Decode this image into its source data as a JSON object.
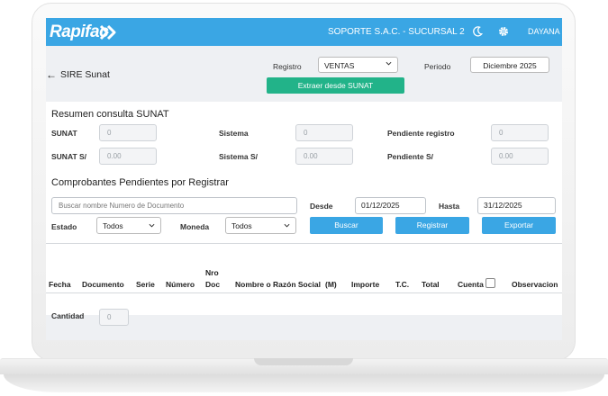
{
  "app": {
    "logo_text": "Rapifac",
    "company": "SOPORTE S.A.C. - SUCURSAL 2",
    "user": "DAYANA",
    "brand_color": "#3aa6e4",
    "accent_green": "#22b389"
  },
  "header": {
    "back_icon": "←",
    "title": "SIRE Sunat",
    "registro_label": "Registro",
    "registro_value": "VENTAS",
    "periodo_label": "Periodo",
    "periodo_value": "Diciembre 2025",
    "extract_button": "Extraer desde SUNAT"
  },
  "summary": {
    "heading": "Resumen consulta SUNAT",
    "sunat_label": "SUNAT",
    "sunat_value": "0",
    "sistema_label": "Sistema",
    "sistema_value": "0",
    "pendiente_registro_label": "Pendiente registro",
    "pendiente_registro_value": "0",
    "sunat_s_label": "SUNAT S/",
    "sunat_s_value": "0.00",
    "sistema_s_label": "Sistema S/",
    "sistema_s_value": "0.00",
    "pendiente_s_label": "Pendiente S/",
    "pendiente_s_value": "0.00"
  },
  "pending": {
    "heading": "Comprobantes Pendientes por Registrar",
    "search_placeholder": "Buscar nombre Numero de Documento",
    "desde_label": "Desde",
    "desde_value": "01/12/2025",
    "hasta_label": "Hasta",
    "hasta_value": "31/12/2025",
    "estado_label": "Estado",
    "estado_value": "Todos",
    "moneda_label": "Moneda",
    "moneda_value": "Todos",
    "buscar_button": "Buscar",
    "registrar_button": "Registrar",
    "exportar_button": "Exportar"
  },
  "table": {
    "columns": {
      "fecha": "Fecha",
      "documento": "Documento",
      "serie": "Serie",
      "numero": "Número",
      "nro_doc_1": "Nro",
      "nro_doc_2": "Doc",
      "nombre": "Nombre o Razón Social",
      "m": "(M)",
      "importe": "Importe",
      "tc": "T.C.",
      "total": "Total",
      "cuenta": "Cuenta",
      "observacion": "Observacion"
    },
    "cantidad_label": "Cantidad",
    "cantidad_value": "0"
  }
}
